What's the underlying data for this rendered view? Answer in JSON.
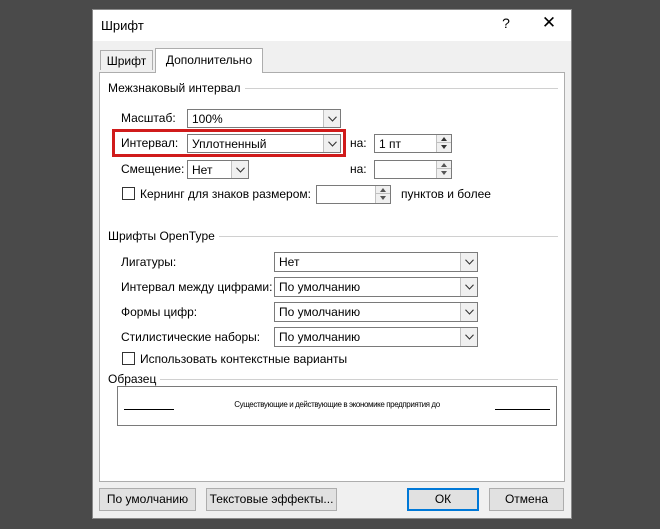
{
  "dialog": {
    "title": "Шрифт",
    "help": "?",
    "close": "✕"
  },
  "tabs": [
    {
      "label": "Шрифт",
      "active": false
    },
    {
      "label": "Дополнительно",
      "active": true
    }
  ],
  "spacing": {
    "group_label": "Межзнаковый интервал",
    "scale_label": "Масштаб:",
    "scale_value": "100%",
    "interval_label": "Интервал:",
    "interval_value": "Уплотненный",
    "interval_by_label": "на:",
    "interval_by_value": "1 пт",
    "offset_label": "Смещение:",
    "offset_value": "Нет",
    "offset_by_label": "на:",
    "offset_by_value": "",
    "kerning_label": "Кернинг для знаков размером:",
    "kerning_value": "",
    "kerning_suffix": "пунктов и более",
    "highlight_color": "#d01b1b"
  },
  "opentype": {
    "group_label": "Шрифты OpenType",
    "ligatures_label": "Лигатуры:",
    "ligatures_value": "Нет",
    "digit_spacing_label": "Интервал между цифрами:",
    "digit_spacing_value": "По умолчанию",
    "digit_forms_label": "Формы цифр:",
    "digit_forms_value": "По умолчанию",
    "stylistic_label": "Стилистические наборы:",
    "stylistic_value": "По умолчанию",
    "contextual_label": "Использовать контекстные варианты"
  },
  "sample": {
    "group_label": "Образец",
    "text": "Существующие и действующие в экономике предприятия до"
  },
  "buttons": {
    "default": "По умолчанию",
    "effects": "Текстовые эффекты...",
    "ok": "ОК",
    "cancel": "Отмена",
    "ok_border_color": "#0078d7"
  }
}
